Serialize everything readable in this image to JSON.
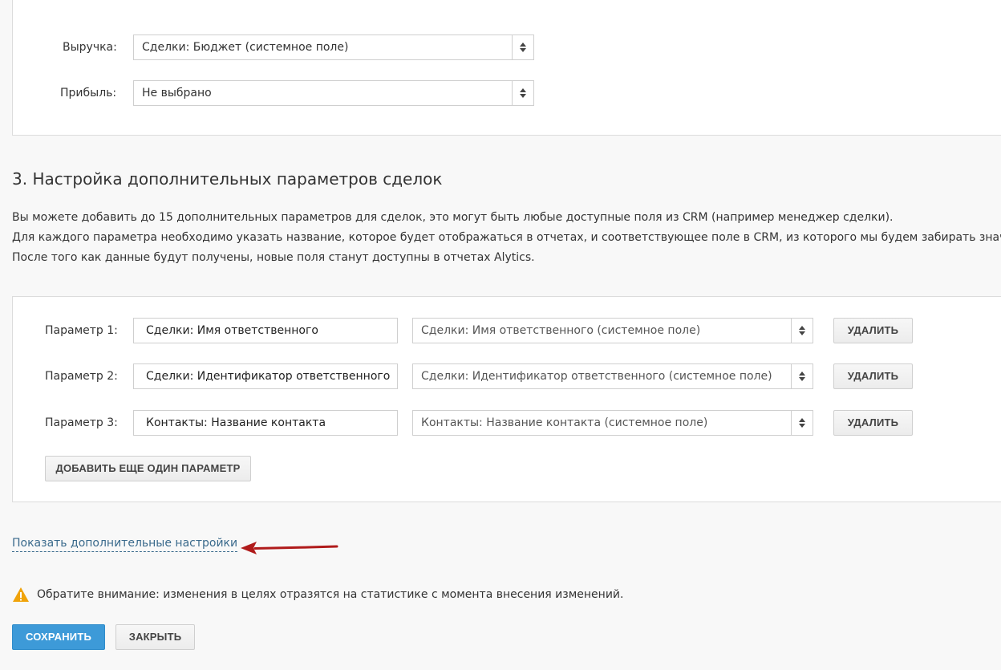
{
  "goals": {
    "revenue": {
      "label": "Выручка:",
      "value": "Сделки: Бюджет (системное поле)"
    },
    "profit": {
      "label": "Прибыль:",
      "value": "Не выбрано"
    }
  },
  "section3": {
    "title": "3. Настройка дополнительных параметров сделок",
    "description": [
      "Вы можете добавить до 15 дополнительных параметров для сделок, это могут быть любые доступные поля из CRM (например менеджер сделки).",
      "Для каждого параметра необходимо указать название, которое будет отображаться в отчетах, и соответствующее поле в CRM, из которого мы будем забирать значение.",
      "После того как данные будут получены, новые поля станут доступны в отчетах Alytics."
    ],
    "params": [
      {
        "label": "Параметр 1:",
        "name": "Сделки: Имя ответственного",
        "field": "Сделки: Имя ответственного (системное поле)",
        "delete": "УДАЛИТЬ"
      },
      {
        "label": "Параметр 2:",
        "name": "Сделки: Идентификатор ответственного",
        "field": "Сделки: Идентификатор ответственного (системное поле)",
        "delete": "УДАЛИТЬ"
      },
      {
        "label": "Параметр 3:",
        "name": "Контакты: Название контакта",
        "field": "Контакты: Название контакта (системное поле)",
        "delete": "УДАЛИТЬ"
      }
    ],
    "add_button": "ДОБАВИТЬ ЕЩЕ ОДИН ПАРАМЕТР"
  },
  "show_more_link": "Показать дополнительные настройки",
  "notice": {
    "text": "Обратите внимание: изменения в целях отразятся на статистике с момента внесения изменений.",
    "icon": "warning-icon",
    "icon_color": "#f0a30a"
  },
  "actions": {
    "save": "СОХРАНИТЬ",
    "close": "ЗАКРЫТЬ"
  },
  "annotation": {
    "arrow_color": "#b01b1b"
  },
  "colors": {
    "primary": "#3d9ad8",
    "link": "#3a6a8c"
  }
}
